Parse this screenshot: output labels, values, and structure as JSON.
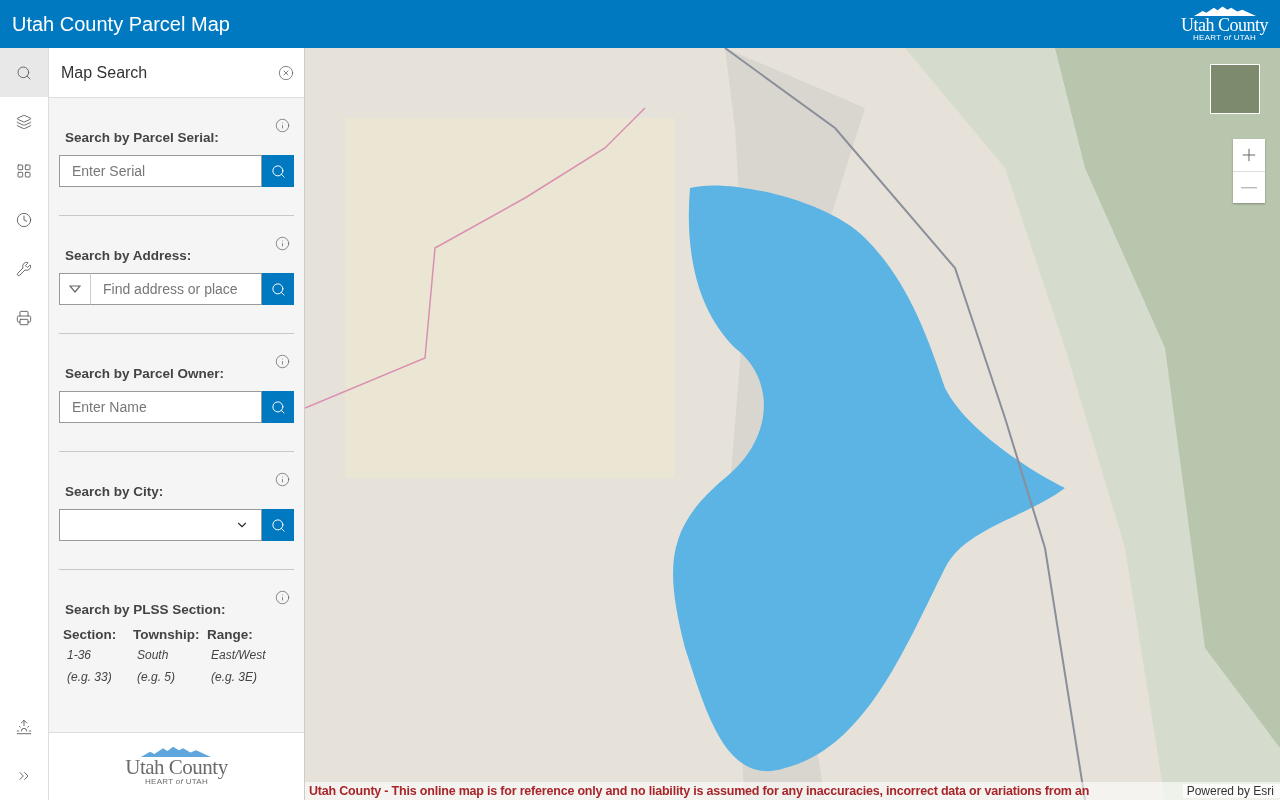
{
  "header": {
    "title": "Utah County Parcel Map",
    "logo": {
      "name": "Utah County",
      "tagline": "HEART *of* UTAH"
    }
  },
  "rail": {
    "tools": [
      {
        "kind": "search",
        "selected": true
      },
      {
        "kind": "layers",
        "selected": false
      },
      {
        "kind": "gallery",
        "selected": false
      },
      {
        "kind": "history",
        "selected": false
      },
      {
        "kind": "tools",
        "selected": false
      },
      {
        "kind": "print",
        "selected": false
      }
    ],
    "bottom_tools": [
      {
        "kind": "daylight",
        "selected": false
      },
      {
        "kind": "expand",
        "selected": false
      }
    ]
  },
  "panel": {
    "title": "Map Search",
    "sections": [
      {
        "kind": "text",
        "heading": "Search by Parcel Serial:",
        "placeholder": "Enter Serial"
      },
      {
        "kind": "geocoder",
        "heading": "Search by Address:",
        "placeholder": "Find address or place"
      },
      {
        "kind": "text",
        "heading": "Search by Parcel Owner:",
        "placeholder": "Enter Name"
      },
      {
        "kind": "select",
        "heading": "Search by City:"
      },
      {
        "kind": "plss",
        "heading": "Search by PLSS Section:",
        "columns": [
          {
            "label": "Section:",
            "range": "1-36",
            "example": "(e.g. 33)"
          },
          {
            "label": "Township:",
            "range": "South",
            "example": "(e.g. 5)"
          },
          {
            "label": "Range:",
            "range": "East/West",
            "example": "(e.g. 3E)"
          }
        ]
      }
    ],
    "footer_logo": {
      "name": "Utah County",
      "tagline": "HEART *of* UTAH"
    }
  },
  "map": {
    "disclaimer": "Utah County - This online map is for reference only and no liability is assumed for any inaccuracies, incorrect data or variations from an",
    "attribution": "Powered by Esri"
  }
}
